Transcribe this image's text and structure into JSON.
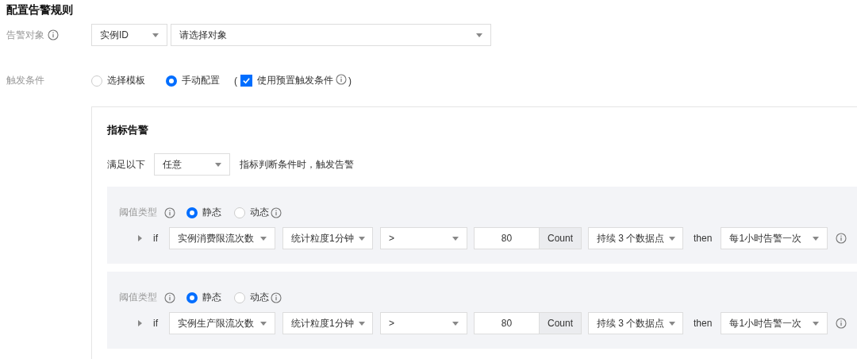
{
  "title": "配置告警规则",
  "target": {
    "label": "告警对象",
    "type_select": "实例ID",
    "object_select": {
      "placeholder": "请选择对象"
    }
  },
  "trigger": {
    "label": "触发条件",
    "options": [
      {
        "label": "选择模板",
        "selected": false
      },
      {
        "label": "手动配置",
        "selected": true
      }
    ],
    "open": "(",
    "preset": {
      "label": "使用预置触发条件",
      "checked": true
    },
    "close": ")"
  },
  "panel": {
    "title": "指标告警",
    "match": {
      "prefix": "满足以下",
      "value": "任意",
      "suffix": "指标判断条件时，触发告警"
    },
    "rules": [
      {
        "threshold_label": "阈值类型",
        "threshold_options": [
          {
            "label": "静态",
            "selected": true
          },
          {
            "label": "动态",
            "selected": false
          }
        ],
        "if": "if",
        "metric": "实例消费限流次数",
        "period": "统计粒度1分钟",
        "operator": ">",
        "value": "80",
        "unit": "Count",
        "duration": "持续 3 个数据点",
        "then": "then",
        "frequency": "每1小时告警一次"
      },
      {
        "threshold_label": "阈值类型",
        "threshold_options": [
          {
            "label": "静态",
            "selected": true
          },
          {
            "label": "动态",
            "selected": false
          }
        ],
        "if": "if",
        "metric": "实例生产限流次数",
        "period": "统计粒度1分钟",
        "operator": ">",
        "value": "80",
        "unit": "Count",
        "duration": "持续 3 个数据点",
        "then": "then",
        "frequency": "每1小时告警一次"
      }
    ]
  }
}
